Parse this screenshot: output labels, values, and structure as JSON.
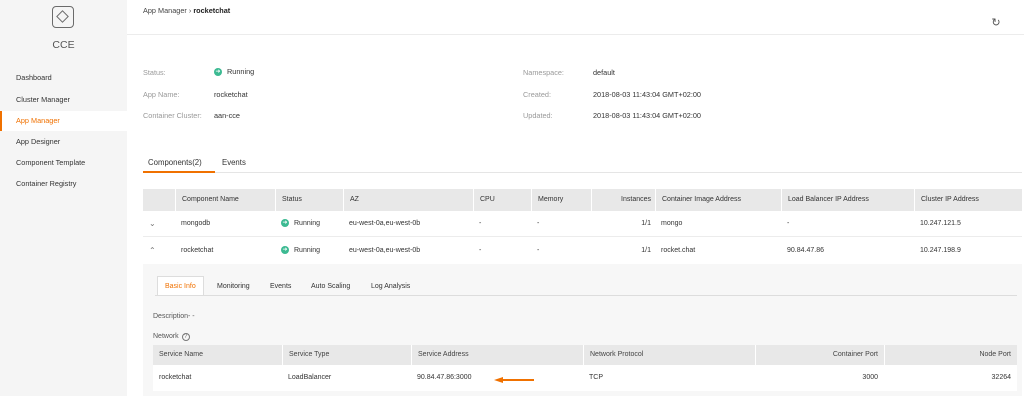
{
  "app": {
    "logo_text": "CCE"
  },
  "sidebar": {
    "items": [
      {
        "label": "Dashboard"
      },
      {
        "label": "Cluster Manager"
      },
      {
        "label": "App Manager"
      },
      {
        "label": "App Designer"
      },
      {
        "label": "Component Template"
      },
      {
        "label": "Container Registry"
      }
    ],
    "active_index": 2
  },
  "breadcrumb": {
    "parent": "App Manager",
    "separator": "›",
    "current": "rocketchat"
  },
  "summary": {
    "status_label": "Status:",
    "status_value": "Running",
    "app_name_label": "App Name:",
    "app_name_value": "rocketchat",
    "cluster_label": "Container Cluster:",
    "cluster_value": "aan-cce",
    "namespace_label": "Namespace:",
    "namespace_value": "default",
    "created_label": "Created:",
    "created_value": "2018-08-03 11:43:04 GMT+02:00",
    "updated_label": "Updated:",
    "updated_value": "2018-08-03 11:43:04 GMT+02:00"
  },
  "tabs": {
    "components": "Components(2)",
    "events": "Events"
  },
  "components_table": {
    "headers": [
      "Component Name",
      "Status",
      "AZ",
      "CPU",
      "Memory",
      "Instances",
      "Container Image Address",
      "Load Balancer IP Address",
      "Cluster IP Address"
    ],
    "rows": [
      {
        "chevron": "⌄",
        "name": "mongodb",
        "status": "Running",
        "az": "eu-west-0a,eu-west-0b",
        "cpu": "-",
        "memory": "-",
        "instances": "1/1",
        "image": "mongo",
        "lb_ip": "-",
        "cluster_ip": "10.247.121.5"
      },
      {
        "chevron": "⌃",
        "name": "rocketchat",
        "status": "Running",
        "az": "eu-west-0a,eu-west-0b",
        "cpu": "-",
        "memory": "-",
        "instances": "1/1",
        "image": "rocket.chat",
        "lb_ip": "90.84.47.86",
        "cluster_ip": "10.247.198.9"
      }
    ]
  },
  "detail": {
    "subtabs": [
      "Basic Info",
      "Monitoring",
      "Events",
      "Auto Scaling",
      "Log Analysis"
    ],
    "description": "Description- -",
    "network_label": "Network",
    "service_headers": [
      "Service Name",
      "Service Type",
      "Service Address",
      "Network Protocol",
      "Container Port",
      "Node Port"
    ],
    "service_row": {
      "name": "rocketchat",
      "type": "LoadBalancer",
      "address": "90.84.47.86:3000",
      "protocol": "TCP",
      "container_port": "3000",
      "node_port": "32264"
    }
  },
  "colors": {
    "accent": "#f07100",
    "running": "#3cba92"
  }
}
